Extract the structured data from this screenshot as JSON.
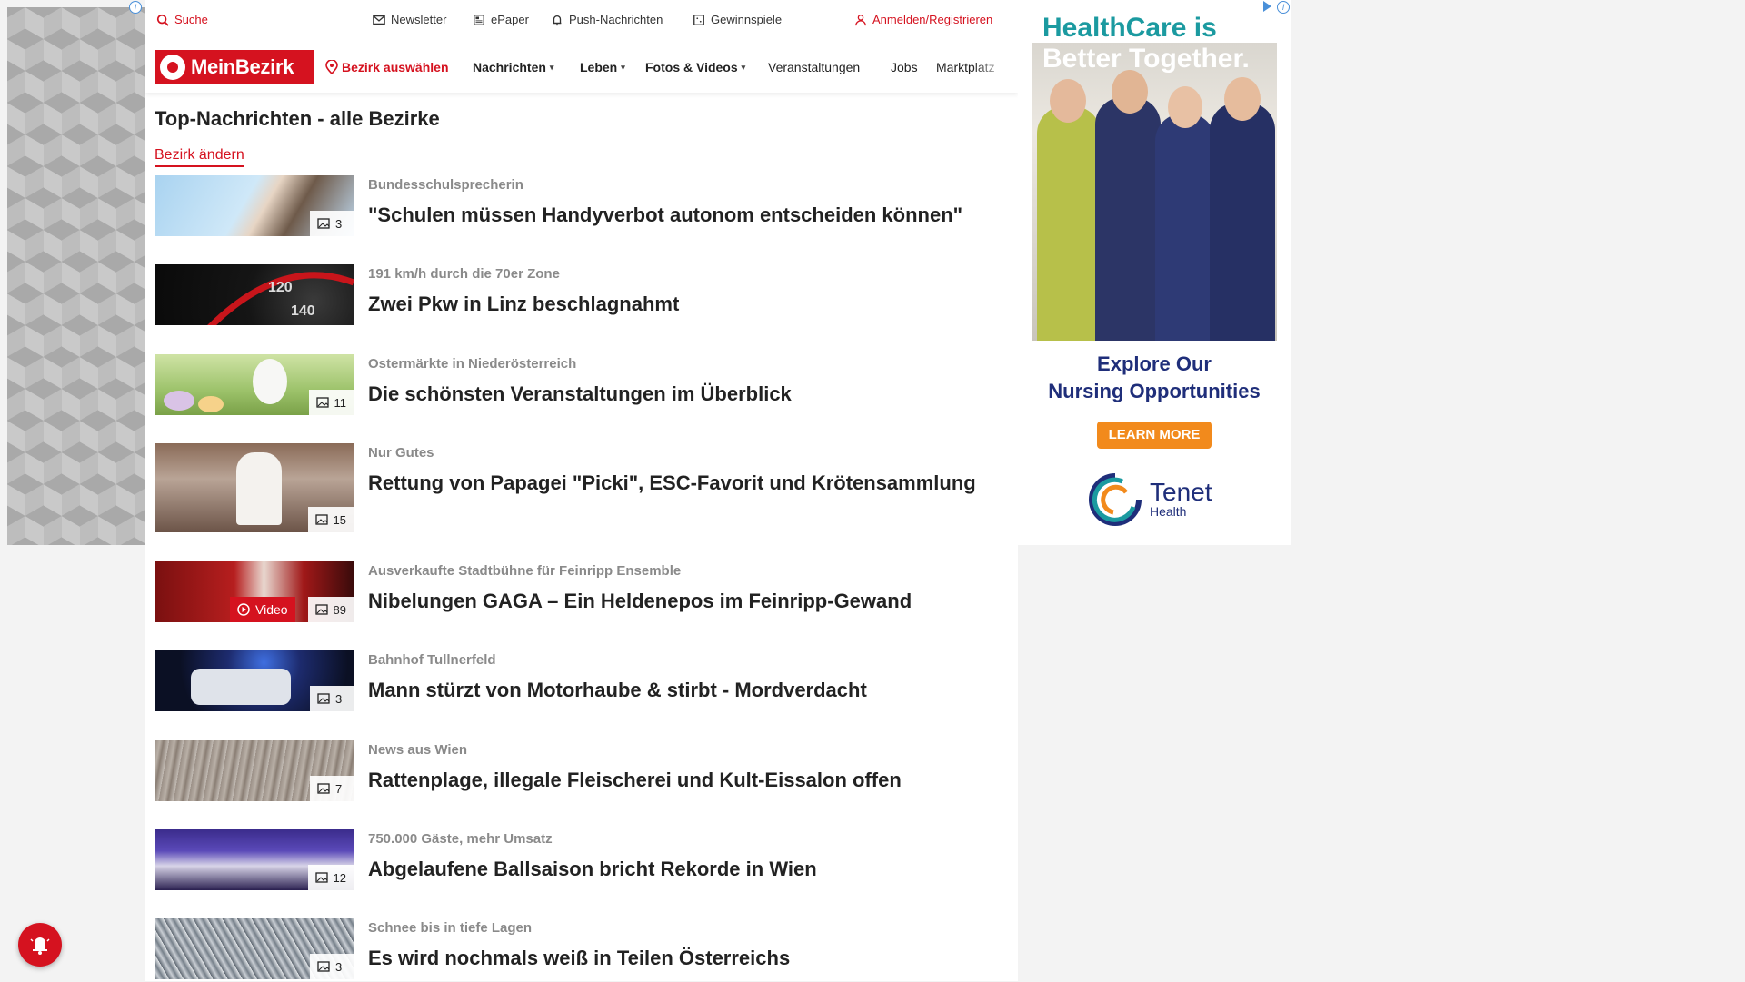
{
  "topbar": {
    "search_label": "Suche",
    "newsletter_label": "Newsletter",
    "epaper_label": "ePaper",
    "push_label": "Push-Nachrichten",
    "games_label": "Gewinnspiele",
    "login_label": "Anmelden/Registrieren"
  },
  "nav": {
    "logo_text": "MeinBezirk",
    "district_select_label": "Bezirk auswählen",
    "items": [
      "Nachrichten",
      "Leben",
      "Fotos & Videos",
      "Veranstaltungen",
      "Jobs",
      "Marktplatz"
    ]
  },
  "page": {
    "title": "Top-Nachrichten - alle Bezirke",
    "change_district_label": "Bezirk ändern"
  },
  "articles": [
    {
      "kicker": "Bundesschulsprecherin",
      "headline": "\"Schulen müssen Handyverbot autonom entscheiden können\"",
      "count": "3"
    },
    {
      "kicker": "191 km/h durch die 70er Zone",
      "headline": "Zwei Pkw in Linz beschlagnahmt"
    },
    {
      "kicker": "Ostermärkte in Niederösterreich",
      "headline": "Die schönsten Veranstaltungen im Überblick",
      "count": "11"
    },
    {
      "kicker": "Nur Gutes",
      "headline": "Rettung von Papagei \"Picki\", ESC-Favorit und Krötensammlung",
      "count": "15"
    },
    {
      "kicker": "Ausverkaufte Stadtbühne für Feinripp Ensemble",
      "headline": "Nibelungen GAGA – Ein Heldenepos im Feinripp-Gewand",
      "count": "89",
      "video_label": "Video"
    },
    {
      "kicker": "Bahnhof Tullnerfeld",
      "headline": "Mann stürzt von Motorhaube & stirbt - Mordverdacht",
      "count": "3"
    },
    {
      "kicker": "News aus Wien",
      "headline": "Rattenplage, illegale Fleischerei und Kult-Eissalon offen",
      "count": "7"
    },
    {
      "kicker": "750.000 Gäste, mehr Umsatz",
      "headline": "Abgelaufene Ballsaison bricht Rekorde in Wien",
      "count": "12"
    },
    {
      "kicker": "Schnee bis in tiefe Lagen",
      "headline": "Es wird nochmals weiß in Teilen Österreichs",
      "count": "3"
    }
  ],
  "ad": {
    "headline_1": "HealthCare is",
    "headline_2": "Better Together.",
    "tagline_1": "Explore Our",
    "tagline_2": "Nursing Opportunities",
    "cta": "LEARN MORE",
    "brand": "Tenet",
    "brand_sub": "Health"
  },
  "colors": {
    "brand_red": "#d5121f",
    "ad_teal": "#1b9aa0",
    "ad_navy": "#1f2e7a",
    "ad_orange": "#f28a1c"
  }
}
